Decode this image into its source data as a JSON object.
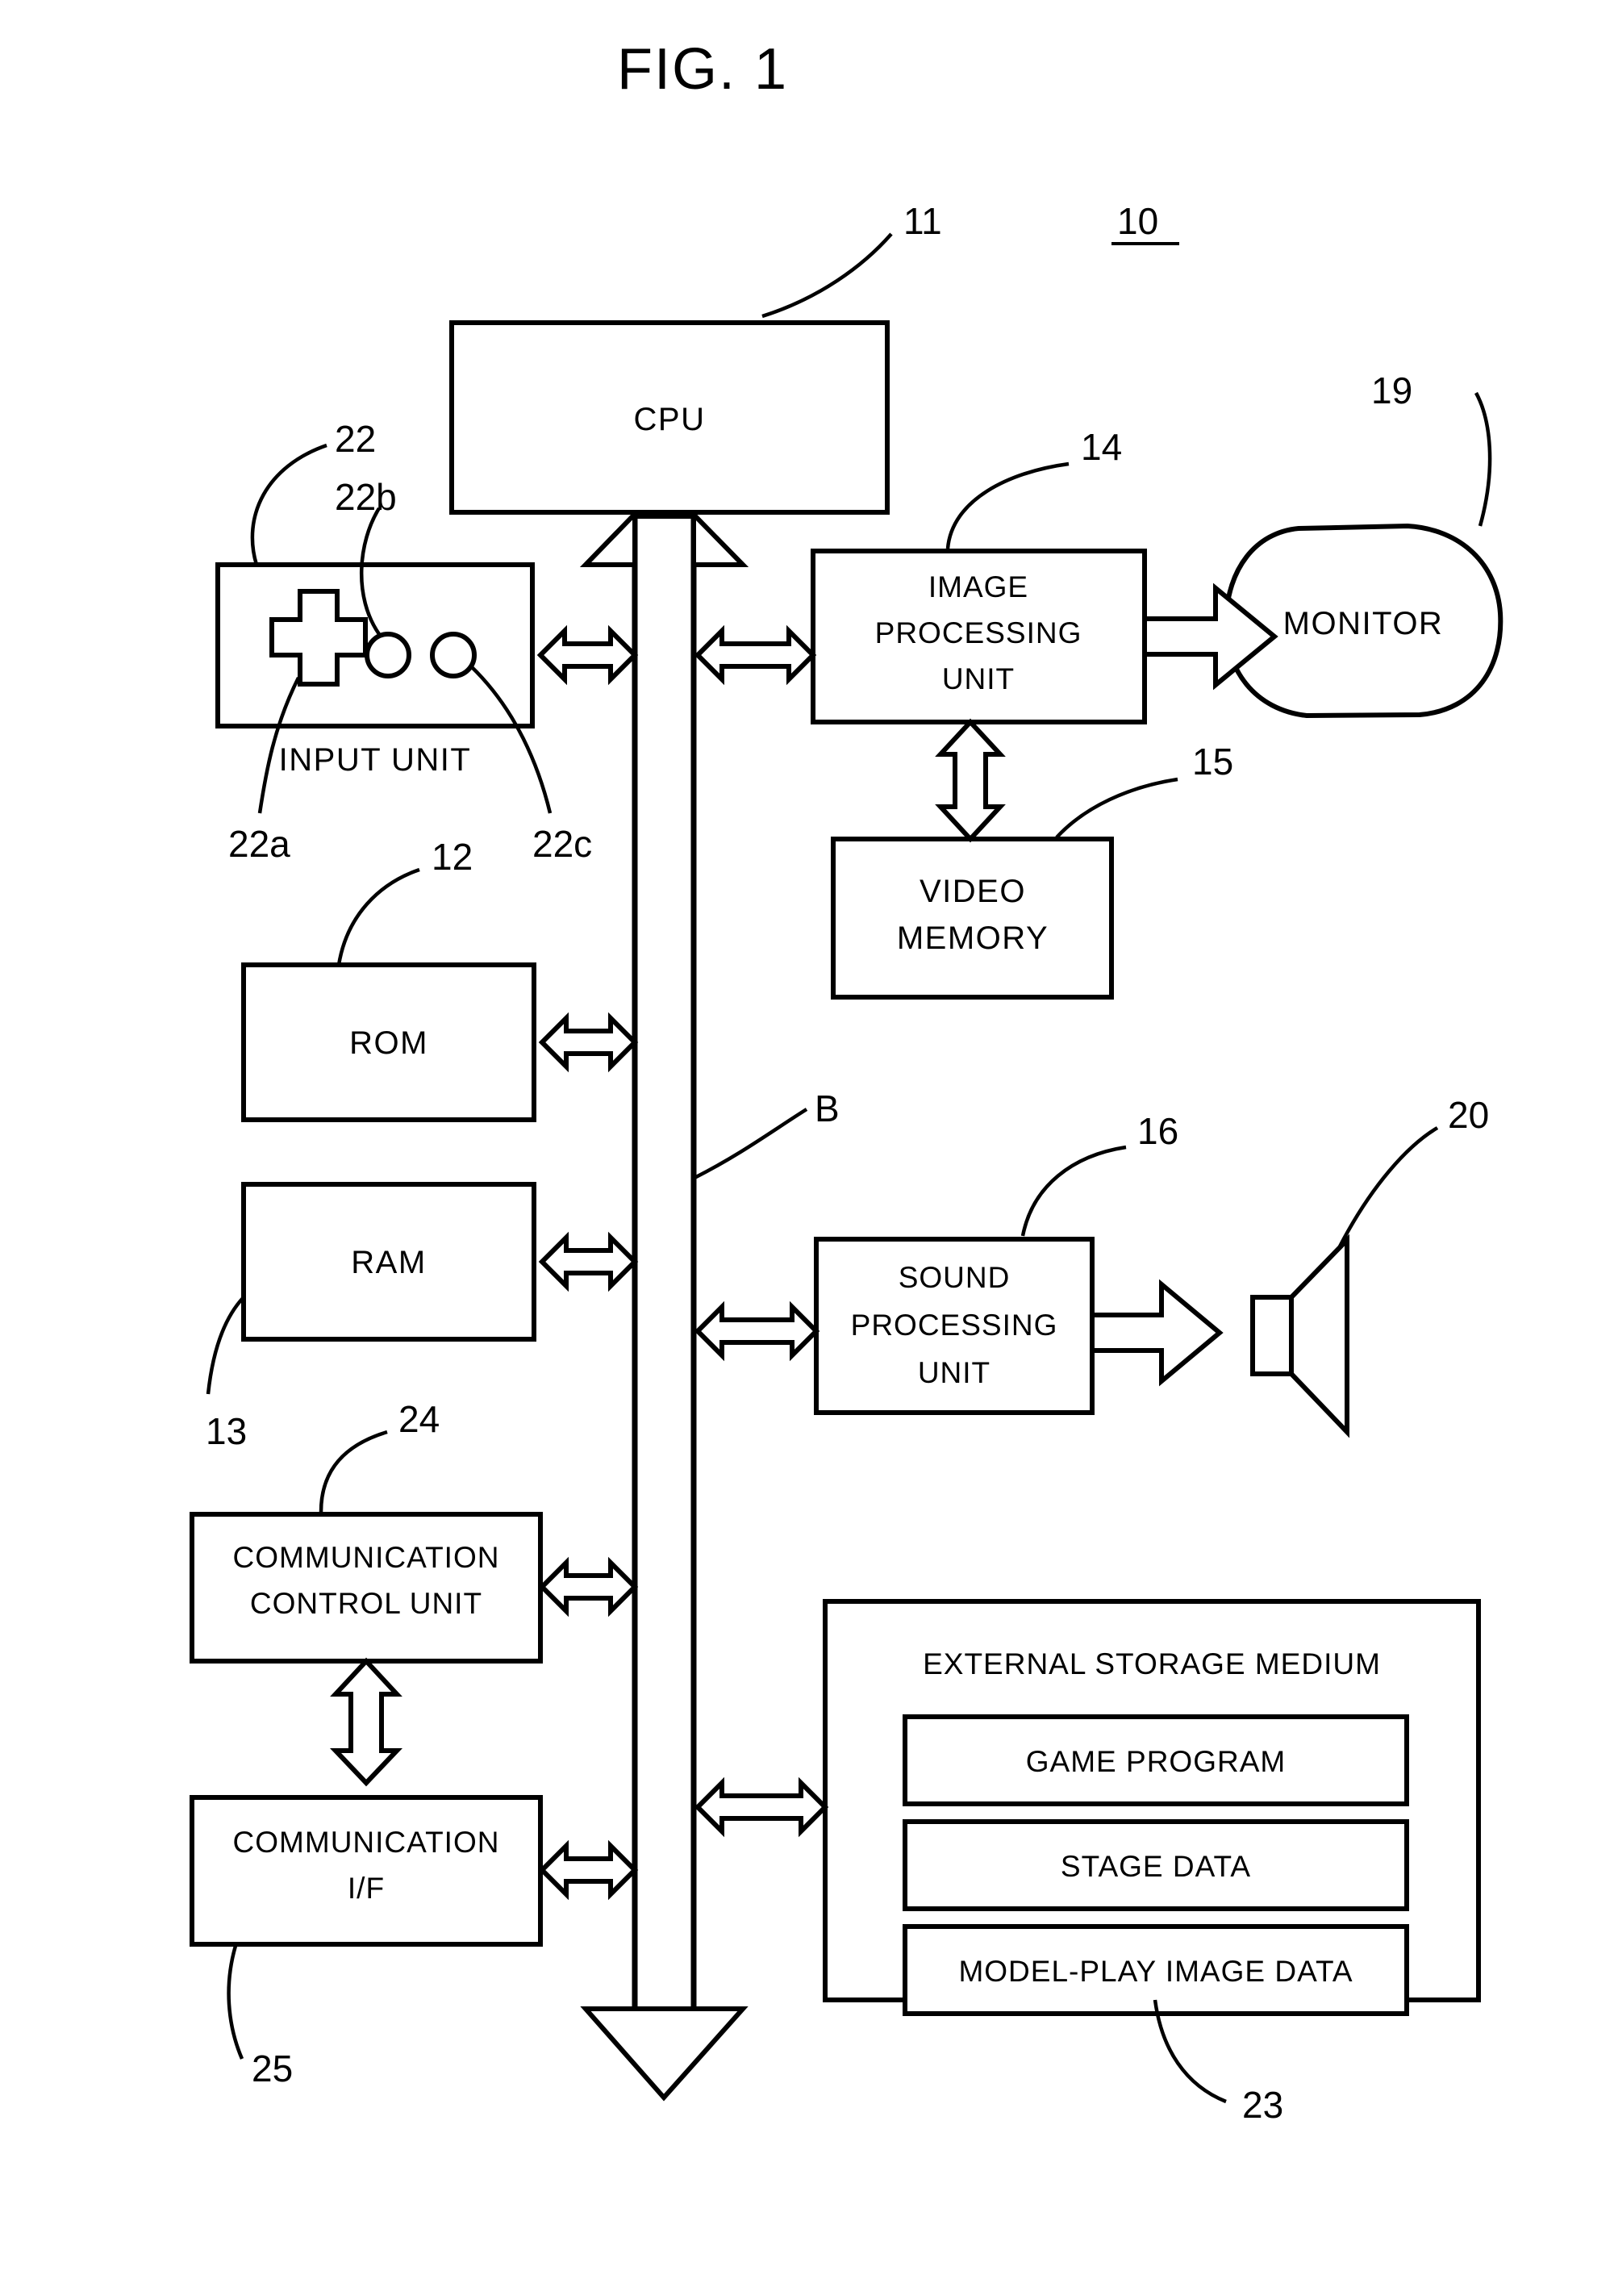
{
  "figure": {
    "title": "FIG. 1",
    "system_ref": "10",
    "bus_label": "B"
  },
  "blocks": {
    "cpu": {
      "label": "CPU",
      "ref": "11"
    },
    "input_unit": {
      "caption": "INPUT UNIT",
      "ref": "22",
      "dpad_ref": "22a",
      "button_b_ref": "22b",
      "button_c_ref": "22c"
    },
    "image_processing_unit": {
      "line1": "IMAGE",
      "line2": "PROCESSING",
      "line3": "UNIT",
      "ref": "14"
    },
    "monitor": {
      "label": "MONITOR",
      "ref": "19"
    },
    "video_memory": {
      "line1": "VIDEO",
      "line2": "MEMORY",
      "ref": "15"
    },
    "rom": {
      "label": "ROM",
      "ref": "12"
    },
    "ram": {
      "label": "RAM",
      "ref": "13"
    },
    "sound_processing_unit": {
      "line1": "SOUND",
      "line2": "PROCESSING",
      "line3": "UNIT",
      "ref": "16"
    },
    "speaker": {
      "ref": "20"
    },
    "communication_control_unit": {
      "line1": "COMMUNICATION",
      "line2": "CONTROL UNIT",
      "ref": "24"
    },
    "communication_if": {
      "line1": "COMMUNICATION",
      "line2": "I/F",
      "ref": "25"
    },
    "external_storage_medium": {
      "title": "EXTERNAL STORAGE MEDIUM",
      "ref": "23",
      "items": [
        {
          "label": "GAME PROGRAM"
        },
        {
          "label": "STAGE DATA"
        },
        {
          "label": "MODEL-PLAY IMAGE DATA"
        }
      ]
    }
  }
}
